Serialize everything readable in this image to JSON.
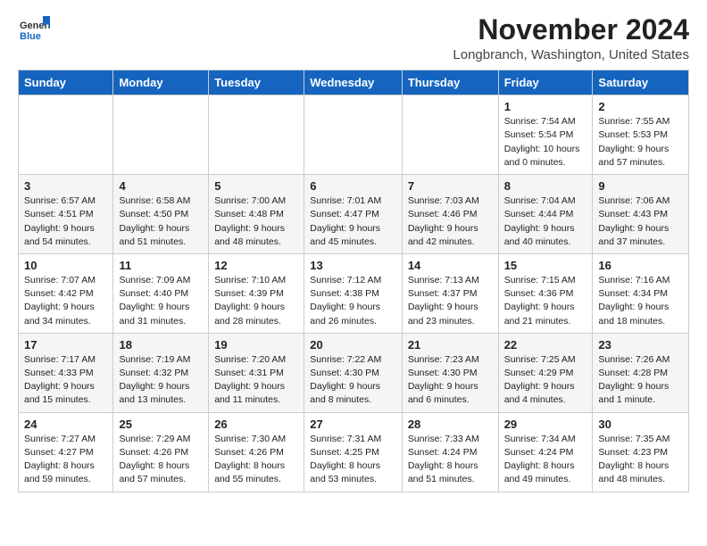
{
  "logo": {
    "general": "General",
    "blue": "Blue"
  },
  "header": {
    "month": "November 2024",
    "location": "Longbranch, Washington, United States"
  },
  "weekdays": [
    "Sunday",
    "Monday",
    "Tuesday",
    "Wednesday",
    "Thursday",
    "Friday",
    "Saturday"
  ],
  "weeks": [
    [
      {
        "day": "",
        "info": ""
      },
      {
        "day": "",
        "info": ""
      },
      {
        "day": "",
        "info": ""
      },
      {
        "day": "",
        "info": ""
      },
      {
        "day": "",
        "info": ""
      },
      {
        "day": "1",
        "info": "Sunrise: 7:54 AM\nSunset: 5:54 PM\nDaylight: 10 hours\nand 0 minutes."
      },
      {
        "day": "2",
        "info": "Sunrise: 7:55 AM\nSunset: 5:53 PM\nDaylight: 9 hours\nand 57 minutes."
      }
    ],
    [
      {
        "day": "3",
        "info": "Sunrise: 6:57 AM\nSunset: 4:51 PM\nDaylight: 9 hours\nand 54 minutes."
      },
      {
        "day": "4",
        "info": "Sunrise: 6:58 AM\nSunset: 4:50 PM\nDaylight: 9 hours\nand 51 minutes."
      },
      {
        "day": "5",
        "info": "Sunrise: 7:00 AM\nSunset: 4:48 PM\nDaylight: 9 hours\nand 48 minutes."
      },
      {
        "day": "6",
        "info": "Sunrise: 7:01 AM\nSunset: 4:47 PM\nDaylight: 9 hours\nand 45 minutes."
      },
      {
        "day": "7",
        "info": "Sunrise: 7:03 AM\nSunset: 4:46 PM\nDaylight: 9 hours\nand 42 minutes."
      },
      {
        "day": "8",
        "info": "Sunrise: 7:04 AM\nSunset: 4:44 PM\nDaylight: 9 hours\nand 40 minutes."
      },
      {
        "day": "9",
        "info": "Sunrise: 7:06 AM\nSunset: 4:43 PM\nDaylight: 9 hours\nand 37 minutes."
      }
    ],
    [
      {
        "day": "10",
        "info": "Sunrise: 7:07 AM\nSunset: 4:42 PM\nDaylight: 9 hours\nand 34 minutes."
      },
      {
        "day": "11",
        "info": "Sunrise: 7:09 AM\nSunset: 4:40 PM\nDaylight: 9 hours\nand 31 minutes."
      },
      {
        "day": "12",
        "info": "Sunrise: 7:10 AM\nSunset: 4:39 PM\nDaylight: 9 hours\nand 28 minutes."
      },
      {
        "day": "13",
        "info": "Sunrise: 7:12 AM\nSunset: 4:38 PM\nDaylight: 9 hours\nand 26 minutes."
      },
      {
        "day": "14",
        "info": "Sunrise: 7:13 AM\nSunset: 4:37 PM\nDaylight: 9 hours\nand 23 minutes."
      },
      {
        "day": "15",
        "info": "Sunrise: 7:15 AM\nSunset: 4:36 PM\nDaylight: 9 hours\nand 21 minutes."
      },
      {
        "day": "16",
        "info": "Sunrise: 7:16 AM\nSunset: 4:34 PM\nDaylight: 9 hours\nand 18 minutes."
      }
    ],
    [
      {
        "day": "17",
        "info": "Sunrise: 7:17 AM\nSunset: 4:33 PM\nDaylight: 9 hours\nand 15 minutes."
      },
      {
        "day": "18",
        "info": "Sunrise: 7:19 AM\nSunset: 4:32 PM\nDaylight: 9 hours\nand 13 minutes."
      },
      {
        "day": "19",
        "info": "Sunrise: 7:20 AM\nSunset: 4:31 PM\nDaylight: 9 hours\nand 11 minutes."
      },
      {
        "day": "20",
        "info": "Sunrise: 7:22 AM\nSunset: 4:30 PM\nDaylight: 9 hours\nand 8 minutes."
      },
      {
        "day": "21",
        "info": "Sunrise: 7:23 AM\nSunset: 4:30 PM\nDaylight: 9 hours\nand 6 minutes."
      },
      {
        "day": "22",
        "info": "Sunrise: 7:25 AM\nSunset: 4:29 PM\nDaylight: 9 hours\nand 4 minutes."
      },
      {
        "day": "23",
        "info": "Sunrise: 7:26 AM\nSunset: 4:28 PM\nDaylight: 9 hours\nand 1 minute."
      }
    ],
    [
      {
        "day": "24",
        "info": "Sunrise: 7:27 AM\nSunset: 4:27 PM\nDaylight: 8 hours\nand 59 minutes."
      },
      {
        "day": "25",
        "info": "Sunrise: 7:29 AM\nSunset: 4:26 PM\nDaylight: 8 hours\nand 57 minutes."
      },
      {
        "day": "26",
        "info": "Sunrise: 7:30 AM\nSunset: 4:26 PM\nDaylight: 8 hours\nand 55 minutes."
      },
      {
        "day": "27",
        "info": "Sunrise: 7:31 AM\nSunset: 4:25 PM\nDaylight: 8 hours\nand 53 minutes."
      },
      {
        "day": "28",
        "info": "Sunrise: 7:33 AM\nSunset: 4:24 PM\nDaylight: 8 hours\nand 51 minutes."
      },
      {
        "day": "29",
        "info": "Sunrise: 7:34 AM\nSunset: 4:24 PM\nDaylight: 8 hours\nand 49 minutes."
      },
      {
        "day": "30",
        "info": "Sunrise: 7:35 AM\nSunset: 4:23 PM\nDaylight: 8 hours\nand 48 minutes."
      }
    ]
  ]
}
